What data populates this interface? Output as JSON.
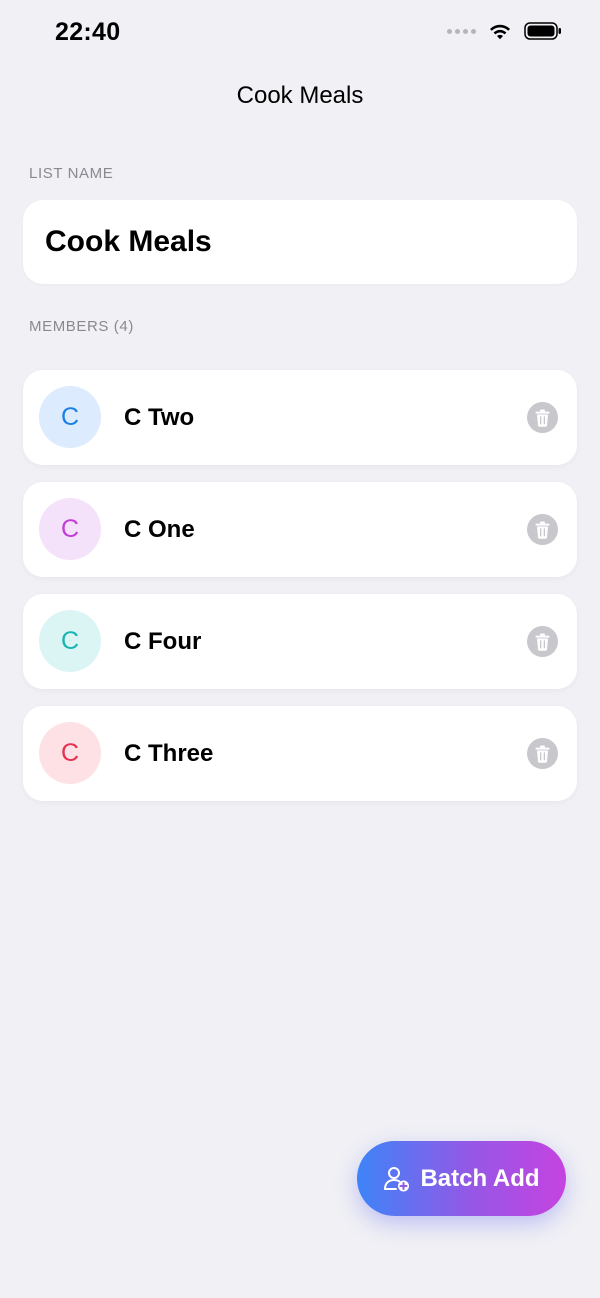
{
  "status_bar": {
    "time": "22:40",
    "icons": [
      "signal-dots-icon",
      "wifi-icon",
      "battery-icon"
    ]
  },
  "nav": {
    "title": "Cook Meals"
  },
  "list_name_section": {
    "label": "LIST NAME",
    "value": "Cook Meals"
  },
  "members_section": {
    "label": "MEMBERS (4)",
    "members": [
      {
        "initial": "C",
        "name": "C Two",
        "avatar_bg": "#DCEBFD",
        "avatar_fg": "#1A80E5"
      },
      {
        "initial": "C",
        "name": "C One",
        "avatar_bg": "#F4E1FA",
        "avatar_fg": "#C23CD9"
      },
      {
        "initial": "C",
        "name": "C Four",
        "avatar_bg": "#DAF5F4",
        "avatar_fg": "#18B5B0"
      },
      {
        "initial": "C",
        "name": "C Three",
        "avatar_bg": "#FDE1E4",
        "avatar_fg": "#E5304F"
      }
    ],
    "delete_icon": "trash-icon"
  },
  "fab": {
    "label": "Batch Add",
    "icon": "add-person-icon",
    "gradient": [
      "#3D84F7",
      "#9657E6",
      "#C643E0"
    ]
  }
}
